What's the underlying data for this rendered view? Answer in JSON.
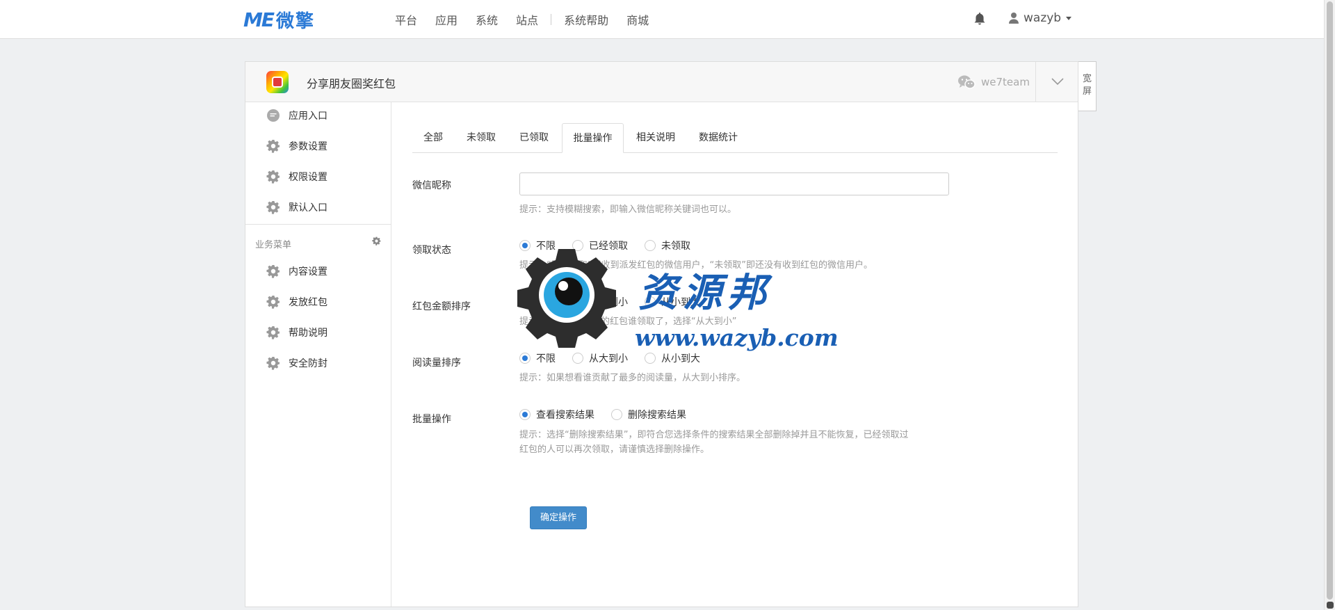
{
  "navbar": {
    "logo_mark": "ME",
    "logo_text": "微擎",
    "links": [
      "平台",
      "应用",
      "系统",
      "站点",
      "系统帮助",
      "商城"
    ],
    "user": "wazyb"
  },
  "app": {
    "title": "分享朋友圈奖红包",
    "account": "we7team",
    "wide_label": "宽屏"
  },
  "sidebar": {
    "top_items": [
      "应用入口",
      "参数设置",
      "权限设置",
      "默认入口"
    ],
    "group_title": "业务菜单",
    "group_items": [
      "内容设置",
      "发放红包",
      "帮助说明",
      "安全防封"
    ]
  },
  "tabs": [
    "全部",
    "未领取",
    "已领取",
    "批量操作",
    "相关说明",
    "数据统计"
  ],
  "active_tab": 3,
  "form": {
    "nickname": {
      "label": "微信昵称",
      "value": "",
      "hint": "提示：支持模糊搜索，即输入微信昵称关键词也可以。"
    },
    "status": {
      "label": "领取状态",
      "options": [
        "不限",
        "已经领取",
        "未领取"
      ],
      "selected": 0,
      "hint": "提示：“已经领取”即收到派发红包的微信用户，“未领取”即还没有收到红包的微信用户。"
    },
    "amount_sort": {
      "label": "红包金额排序",
      "options": [
        "不限",
        "从大到小",
        "从小到大"
      ],
      "selected": 0,
      "hint": "提示：如果想看最多的红包谁领取了，选择“从大到小”"
    },
    "read_sort": {
      "label": "阅读量排序",
      "options": [
        "不限",
        "从大到小",
        "从小到大"
      ],
      "selected": 0,
      "hint": "提示：如果想看谁贡献了最多的阅读量，从大到小排序。"
    },
    "batch": {
      "label": "批量操作",
      "options": [
        "查看搜索结果",
        "删除搜索结果"
      ],
      "selected": 0,
      "hint_line1": "提示：选择“删除搜索结果”，即符合您选择条件的搜索结果全部删除掉并且不能恢复，已经领取过",
      "hint_line2": "红包的人可以再次领取，请谨慎选择删除操作。"
    },
    "submit_label": "确定操作"
  },
  "watermark": {
    "title": "资源邦",
    "url": "www.wazyb.com"
  },
  "colors": {
    "brand": "#2b7ad6",
    "primary_button": "#428bca",
    "watermark": "#1a5fb4"
  }
}
